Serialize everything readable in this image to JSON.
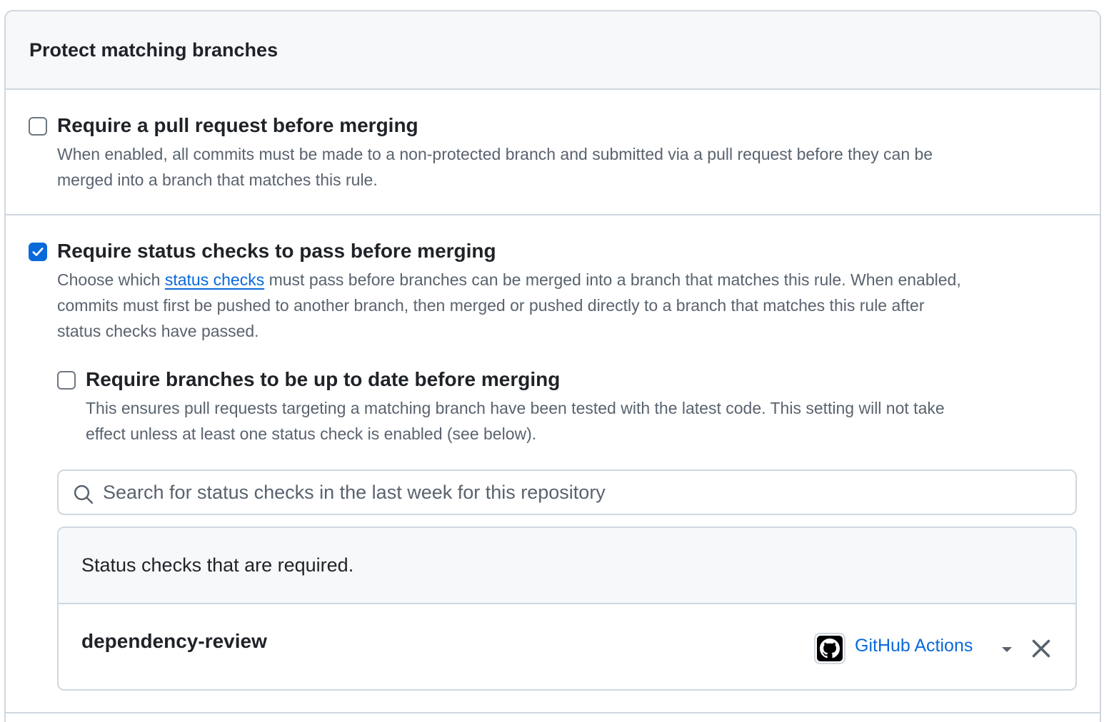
{
  "panel": {
    "title": "Protect matching branches"
  },
  "rules": {
    "pull_request": {
      "checked": false,
      "title": "Require a pull request before merging",
      "desc_line1": "When enabled, all commits must be made to a non-protected branch and submitted via a pull request before they can be",
      "desc_line2": "merged into a branch that matches this rule."
    },
    "status_checks": {
      "checked": true,
      "title": "Require status checks to pass before merging",
      "desc_pre": "Choose which ",
      "desc_link": "status checks",
      "desc_post1": " must pass before branches can be merged into a branch that matches this rule. When enabled,",
      "desc_line2": "commits must first be pushed to another branch, then merged or pushed directly to a branch that matches this rule after",
      "desc_line3": "status checks have passed."
    },
    "up_to_date": {
      "checked": false,
      "title": "Require branches to be up to date before merging",
      "desc_line1": "This ensures pull requests targeting a matching branch have been tested with the latest code. This setting will not take",
      "desc_line2": "effect unless at least one status check is enabled (see below)."
    }
  },
  "search": {
    "placeholder": "Search for status checks in the last week for this repository",
    "value": "",
    "icon": "search-icon"
  },
  "required_checks": {
    "header": "Status checks that are required.",
    "items": [
      {
        "name": "dependency-review",
        "app": "GitHub Actions",
        "app_icon": "github-mark-icon"
      }
    ]
  },
  "colors": {
    "accent": "#0969da",
    "border": "#d0d7de",
    "muted_text": "#59636e",
    "header_bg": "#f6f8fa"
  }
}
